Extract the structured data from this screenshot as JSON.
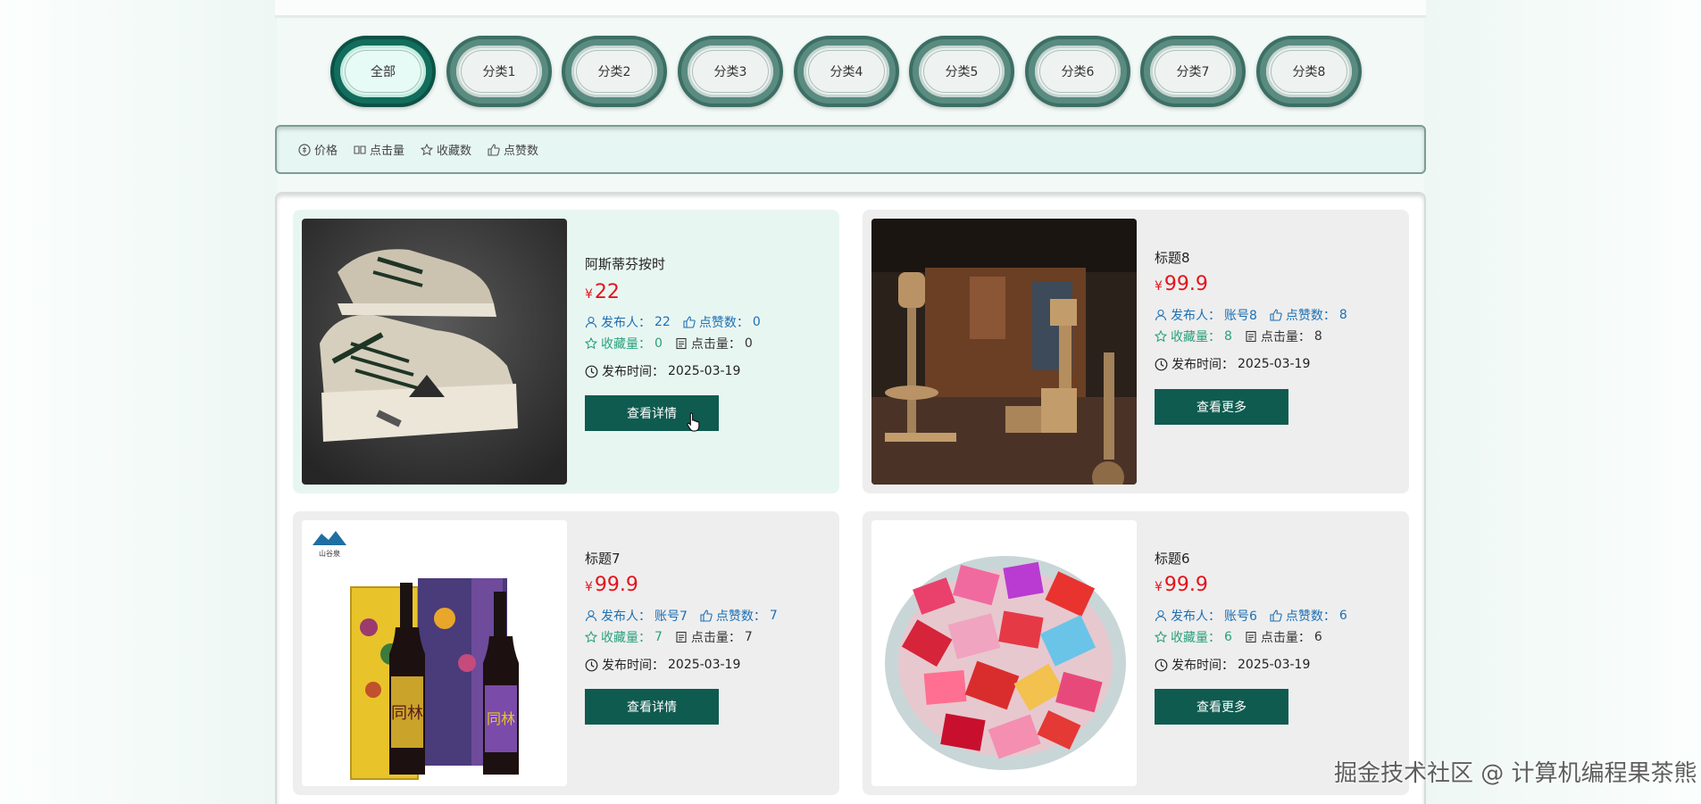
{
  "categories": [
    "全部",
    "分类1",
    "分类2",
    "分类3",
    "分类4",
    "分类5",
    "分类6",
    "分类7",
    "分类8"
  ],
  "sort": {
    "price": "价格",
    "clicks": "点击量",
    "favorites": "收藏数",
    "likes": "点赞数"
  },
  "labels": {
    "publisher": "发布人：",
    "likes": "点赞数：",
    "favorites": "收藏量：",
    "clicks": "点击量：",
    "time": "发布时间：",
    "currency": "¥"
  },
  "cards": [
    {
      "title": "阿斯蒂芬按时",
      "price": "22",
      "publisher": "22",
      "likes": "0",
      "favorites": "0",
      "clicks": "0",
      "time": "2025-03-19",
      "button": "查看详情",
      "image": "sneakers-photo"
    },
    {
      "title": "标题8",
      "price": "99.9",
      "publisher": "账号8",
      "likes": "8",
      "favorites": "8",
      "clicks": "8",
      "time": "2025-03-19",
      "button": "查看更多",
      "image": "cat-tree-room-photo"
    },
    {
      "title": "标题7",
      "price": "99.9",
      "publisher": "账号7",
      "likes": "7",
      "favorites": "7",
      "clicks": "7",
      "time": "2025-03-19",
      "button": "查看详情",
      "image": "wine-bottles-photo"
    },
    {
      "title": "标题6",
      "price": "99.9",
      "publisher": "账号6",
      "likes": "6",
      "favorites": "6",
      "clicks": "6",
      "time": "2025-03-19",
      "button": "查看更多",
      "image": "candy-plate-photo"
    }
  ],
  "wine_brand": "山谷泉",
  "wine_label": "同林",
  "watermark": "掘金技术社区 @ 计算机编程果茶熊",
  "colors": {
    "accent": "#0f5b50",
    "price": "#e3141b",
    "link": "#1d6fb3",
    "green": "#29a07c"
  }
}
